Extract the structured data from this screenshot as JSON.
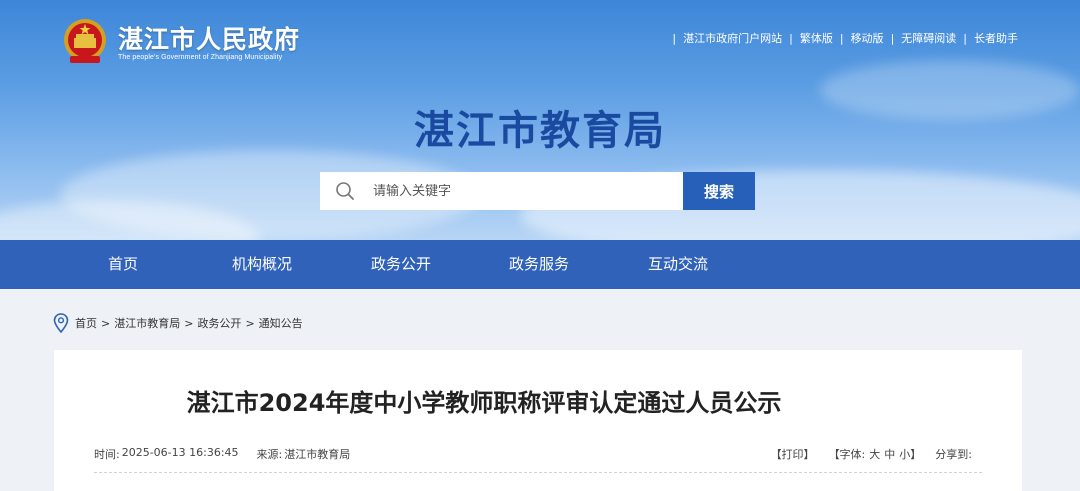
{
  "header": {
    "gov_title": "湛江市人民政府",
    "gov_subtitle": "The people's Government of Zhanjiang Municipality",
    "top_links": [
      "湛江市政府门户网站",
      "繁体版",
      "移动版",
      "无障碍阅读",
      "长者助手"
    ],
    "site_title": "湛江市教育局"
  },
  "search": {
    "placeholder": "请输入关键字",
    "button_label": "搜索"
  },
  "nav": {
    "items": [
      "首页",
      "机构概况",
      "政务公开",
      "政务服务",
      "互动交流"
    ]
  },
  "breadcrumb": {
    "items": [
      "首页",
      "湛江市教育局",
      "政务公开",
      "通知公告"
    ],
    "separator": ">"
  },
  "article": {
    "title": "湛江市2024年度中小学教师职称评审认定通过人员公示",
    "time_label": "时间:",
    "time_value": "2025-06-13 16:36:45",
    "source_label": "来源:",
    "source_value": "湛江市教育局",
    "print_label": "【打印】",
    "font_label": "【字体:",
    "font_large": "大",
    "font_medium": "中",
    "font_small": "小】",
    "share_label": "分享到:"
  },
  "colors": {
    "nav_bg": "#2f62b8",
    "title_blue": "#1a4aa0",
    "search_button": "#2760b8"
  }
}
